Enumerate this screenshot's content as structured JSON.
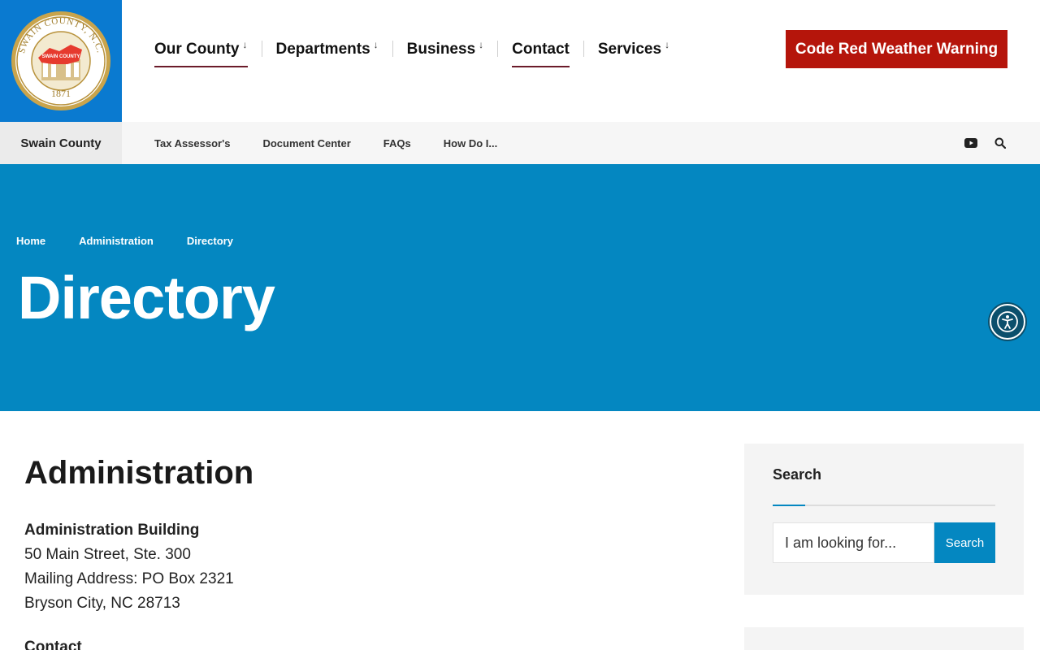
{
  "header": {
    "seal_text": {
      "top": "SWAIN COUNTY, N.C.",
      "center": "SWAIN COUNTY",
      "year": "1871"
    },
    "nav": [
      {
        "label": "Our County",
        "arrow": "↓"
      },
      {
        "label": "Departments",
        "arrow": "↓"
      },
      {
        "label": "Business",
        "arrow": "↓"
      },
      {
        "label": "Contact",
        "arrow": ""
      },
      {
        "label": "Services",
        "arrow": "↓"
      }
    ],
    "alert_button": "Code Red Weather Warning"
  },
  "subnav": {
    "brand": "Swain County",
    "links": [
      "Tax Assessor's",
      "Document Center",
      "FAQs",
      "How Do I..."
    ],
    "icons": [
      "youtube-icon",
      "search-icon"
    ]
  },
  "hero": {
    "breadcrumb": [
      "Home",
      "Administration",
      "Directory"
    ],
    "title": "Directory"
  },
  "main": {
    "heading": "Administration",
    "building_name": "Administration Building",
    "street": "50 Main Street, Ste. 300",
    "mailing": "Mailing Address: PO Box 2321",
    "city": "Bryson City, NC 28713",
    "contact_label": "Contact"
  },
  "sidebar": {
    "search_title": "Search",
    "search_placeholder": "I am looking for...",
    "search_button": "Search"
  },
  "colors": {
    "logo_bg": "#0a7ad0",
    "hero_bg": "#0487c1",
    "alert_bg": "#b5150b",
    "nav_underline": "#6b1b2a",
    "a11y_bg": "#0b4f6c"
  }
}
